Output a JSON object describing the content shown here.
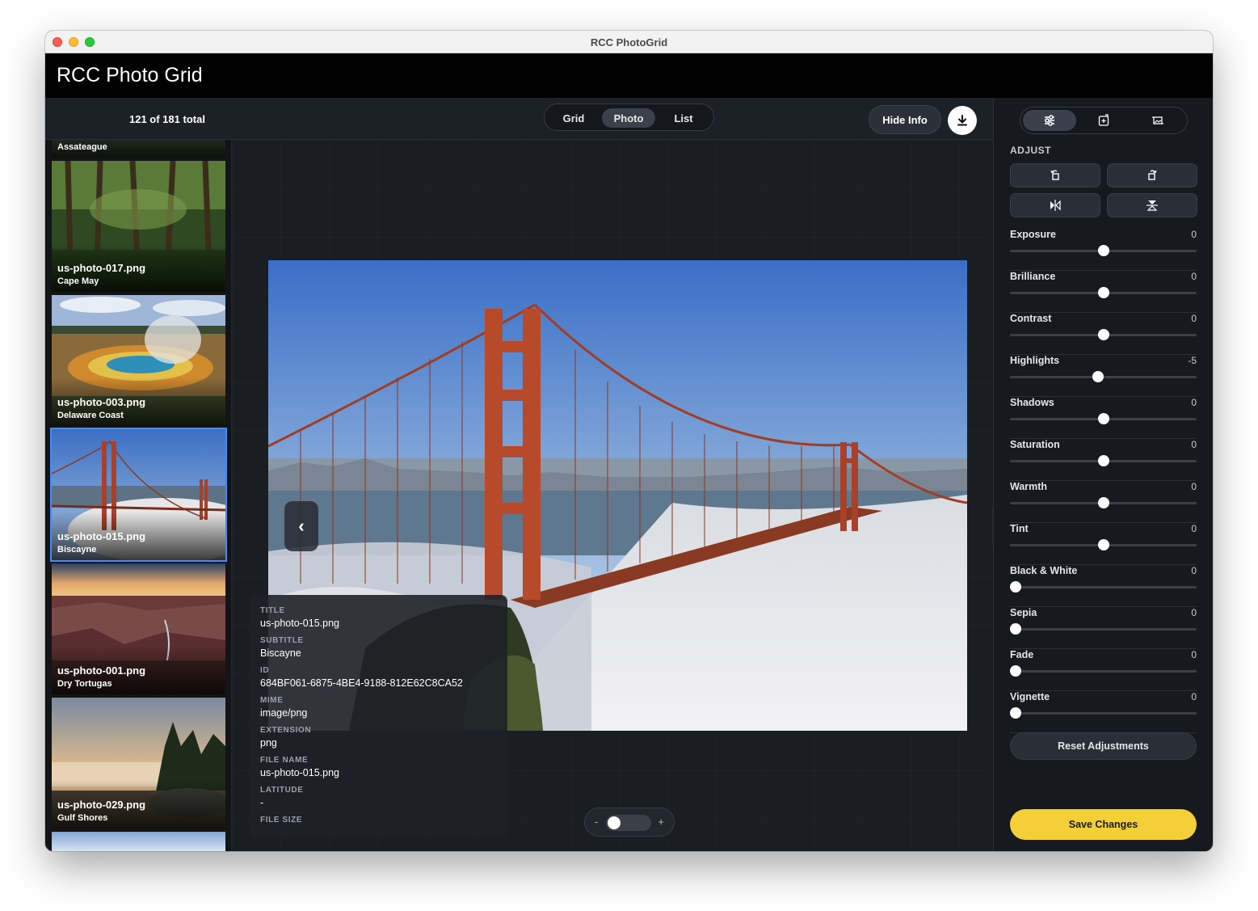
{
  "window": {
    "title": "RCC PhotoGrid"
  },
  "app": {
    "title": "RCC Photo Grid"
  },
  "toolbar": {
    "count": "121 of 181 total",
    "views": [
      "Grid",
      "Photo",
      "List"
    ],
    "active_view": "Photo",
    "hide_info": "Hide Info",
    "download_icon": "download-icon"
  },
  "sidebar": {
    "cut_label": "Assateague",
    "items": [
      {
        "name": "us-photo-017.png",
        "subtitle": "Cape May",
        "selected": false
      },
      {
        "name": "us-photo-003.png",
        "subtitle": "Delaware Coast",
        "selected": false
      },
      {
        "name": "us-photo-015.png",
        "subtitle": "Biscayne",
        "selected": true
      },
      {
        "name": "us-photo-001.png",
        "subtitle": "Dry Tortugas",
        "selected": false
      },
      {
        "name": "us-photo-029.png",
        "subtitle": "Gulf Shores",
        "selected": false
      }
    ]
  },
  "viewer": {
    "prev": "‹",
    "next": "›",
    "info": [
      {
        "label": "TITLE",
        "value": "us-photo-015.png"
      },
      {
        "label": "SUBTITLE",
        "value": "Biscayne"
      },
      {
        "label": "ID",
        "value": "684BF061-6875-4BE4-9188-812E62C8CA52"
      },
      {
        "label": "MIME",
        "value": "image/png"
      },
      {
        "label": "EXTENSION",
        "value": "png"
      },
      {
        "label": "FILE NAME",
        "value": "us-photo-015.png"
      },
      {
        "label": "LATITUDE",
        "value": "-"
      },
      {
        "label": "FILE SIZE",
        "value": ""
      }
    ],
    "zoom": {
      "minus": "-",
      "plus": "+",
      "level": 0
    }
  },
  "panel": {
    "tab_icons": [
      "sliders-icon",
      "crop-add-icon",
      "image-crop-icon"
    ],
    "adjust_heading": "ADJUST",
    "transform_icons": [
      "rotate-left-icon",
      "rotate-right-icon",
      "flip-horizontal-icon",
      "flip-vertical-icon"
    ],
    "sliders": [
      {
        "label": "Exposure",
        "value": "0",
        "fraction": 0.5
      },
      {
        "label": "Brilliance",
        "value": "0",
        "fraction": 0.5
      },
      {
        "label": "Contrast",
        "value": "0",
        "fraction": 0.5
      },
      {
        "label": "Highlights",
        "value": "-5",
        "fraction": 0.47
      },
      {
        "label": "Shadows",
        "value": "0",
        "fraction": 0.5
      },
      {
        "label": "Saturation",
        "value": "0",
        "fraction": 0.5
      },
      {
        "label": "Warmth",
        "value": "0",
        "fraction": 0.5
      },
      {
        "label": "Tint",
        "value": "0",
        "fraction": 0.5
      },
      {
        "label": "Black & White",
        "value": "0",
        "fraction": 0.03
      },
      {
        "label": "Sepia",
        "value": "0",
        "fraction": 0.03
      },
      {
        "label": "Fade",
        "value": "0",
        "fraction": 0.03
      },
      {
        "label": "Vignette",
        "value": "0",
        "fraction": 0.03
      }
    ],
    "reset": "Reset Adjustments",
    "save": "Save Changes"
  },
  "colors": {
    "accent": "#f4cf37",
    "selection": "#3f8cff",
    "background": "#16191e"
  }
}
